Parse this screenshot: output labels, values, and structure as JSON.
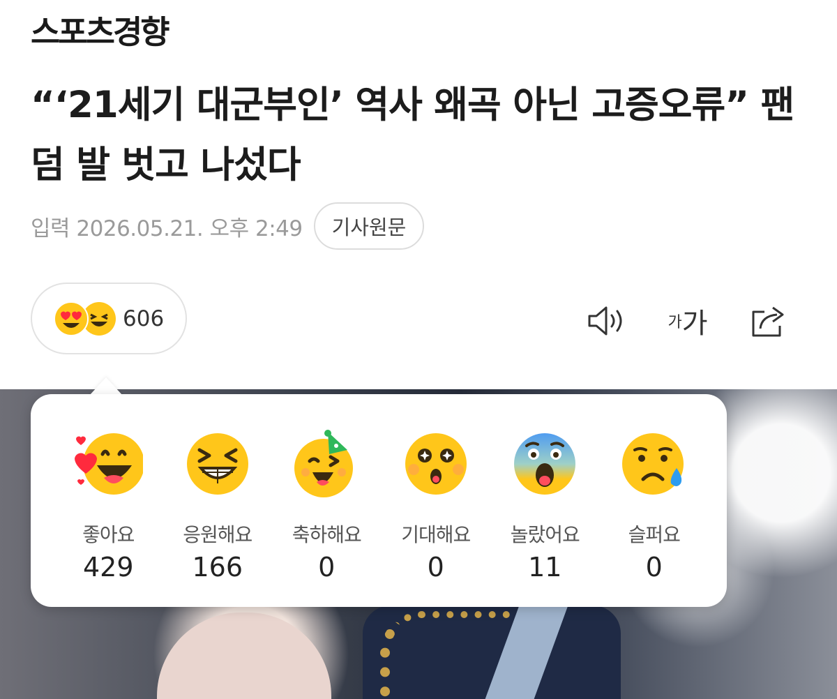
{
  "header": {
    "logo": "스포츠경향"
  },
  "article": {
    "title": "“‘21세기 대군부인’ 역사 왜곡 아닌 고증오류” 팬덤 발 벗고 나섰다",
    "published": "입력 2026.05.21. 오후 2:49",
    "origin_button": "기사원문"
  },
  "reaction_summary": {
    "count": "606",
    "icons": [
      "heart-eyes-icon",
      "laughing-icon"
    ]
  },
  "toolbar": {
    "icons": [
      "speaker-icon",
      "font-size-icon",
      "share-icon"
    ],
    "font_small": "가",
    "font_large": "가"
  },
  "reactions": [
    {
      "label": "좋아요",
      "count": "429",
      "icon": "love-face-icon"
    },
    {
      "label": "응원해요",
      "count": "166",
      "icon": "cheer-face-icon"
    },
    {
      "label": "축하해요",
      "count": "0",
      "icon": "party-face-icon"
    },
    {
      "label": "기대해요",
      "count": "0",
      "icon": "sparkle-eyes-face-icon"
    },
    {
      "label": "놀랐어요",
      "count": "11",
      "icon": "shocked-face-icon"
    },
    {
      "label": "슬퍼요",
      "count": "0",
      "icon": "sad-face-icon"
    }
  ],
  "colors": {
    "emoji_yellow": "#ffc61a",
    "emoji_orange": "#ffa500",
    "heart_red": "#ff2a3d",
    "text_gray": "#9a9a9a"
  }
}
